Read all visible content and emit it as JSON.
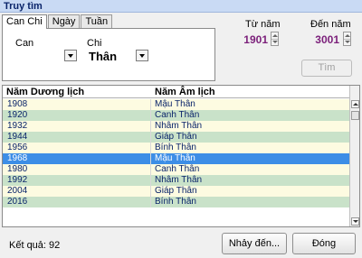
{
  "title": "Truy tìm",
  "tabs": [
    {
      "label": "Can Chi",
      "active": true
    },
    {
      "label": "Ngày",
      "active": false
    },
    {
      "label": "Tuần",
      "active": false
    }
  ],
  "filters": {
    "can_label": "Can",
    "can_value": "",
    "chi_label": "Chi",
    "chi_value": "Thân"
  },
  "range": {
    "from_label": "Từ năm",
    "from_value": "1901",
    "to_label": "Đến năm",
    "to_value": "3001"
  },
  "search_button": "Tìm",
  "table": {
    "headers": [
      "Năm Dương lịch",
      "Năm Âm lịch"
    ],
    "rows": [
      {
        "solar": "1908",
        "lunar": "Mậu Thân"
      },
      {
        "solar": "1920",
        "lunar": "Canh Thân"
      },
      {
        "solar": "1932",
        "lunar": "Nhâm Thân"
      },
      {
        "solar": "1944",
        "lunar": "Giáp Thân"
      },
      {
        "solar": "1956",
        "lunar": "Bính Thân"
      },
      {
        "solar": "1968",
        "lunar": "Mậu Thân"
      },
      {
        "solar": "1980",
        "lunar": "Canh Thân"
      },
      {
        "solar": "1992",
        "lunar": "Nhâm Thân"
      },
      {
        "solar": "2004",
        "lunar": "Giáp Thân"
      },
      {
        "solar": "2016",
        "lunar": "Bính Thân"
      }
    ],
    "selected_index": 5
  },
  "result_text": "Kết quả: 92",
  "jump_button": "Nhảy đến...",
  "close_button": "Đóng",
  "colors": {
    "row_yellow": "#fdfbe1",
    "row_green": "#c9e2c9",
    "row_selected": "#3d8ee6",
    "year_text": "#7b1f7a",
    "title_bar": "#c9daf4"
  }
}
